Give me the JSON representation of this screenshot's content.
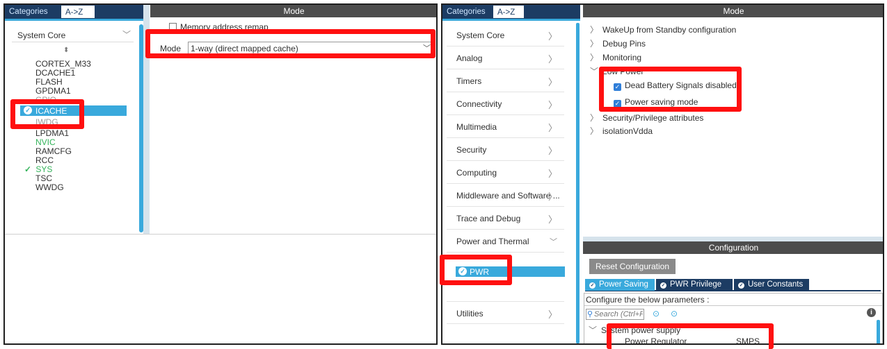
{
  "left": {
    "tabs": [
      "Categories",
      "A->Z"
    ],
    "mode_header": "Mode",
    "category": "System Core",
    "peripherals": [
      {
        "label": "CORTEX_M33",
        "status": "normal"
      },
      {
        "label": "DCACHE1",
        "status": "normal"
      },
      {
        "label": "FLASH",
        "status": "normal"
      },
      {
        "label": "GPDMA1",
        "status": "normal"
      },
      {
        "label": "GPIO",
        "status": "hidden"
      },
      {
        "label": "ICACHE",
        "status": "selected"
      },
      {
        "label": "IWDG",
        "status": "hidden"
      },
      {
        "label": "LPDMA1",
        "status": "normal"
      },
      {
        "label": "NVIC",
        "status": "green"
      },
      {
        "label": "RAMCFG",
        "status": "normal"
      },
      {
        "label": "RCC",
        "status": "normal"
      },
      {
        "label": "SYS",
        "status": "check"
      },
      {
        "label": "TSC",
        "status": "normal"
      },
      {
        "label": "WWDG",
        "status": "normal"
      }
    ],
    "remap_label": "Memory address remap",
    "mode_label": "Mode",
    "mode_value": "1-way (direct mapped cache)"
  },
  "right": {
    "tabs": [
      "Categories",
      "A->Z"
    ],
    "mode_header": "Mode",
    "categories": [
      "System Core",
      "Analog",
      "Timers",
      "Connectivity",
      "Multimedia",
      "Security",
      "Computing",
      "Middleware and Software ...",
      "Trace and Debug",
      "Power and Thermal"
    ],
    "selected_item": "PWR",
    "utilities": "Utilities",
    "mode_tree": [
      {
        "label": "WakeUp from Standby configuration"
      },
      {
        "label": "Debug Pins"
      },
      {
        "label": "Monitoring"
      },
      {
        "label": "Low Power"
      }
    ],
    "checkboxes": [
      "Dead Battery Signals disabled",
      "Power saving mode"
    ],
    "mode_tree_after": [
      {
        "label": "Security/Privilege attributes"
      },
      {
        "label": "isolationVdda"
      }
    ],
    "config_header": "Configuration",
    "reset_button": "Reset Configuration",
    "config_tabs": [
      "Power Saving",
      "PWR Privilege",
      "User Constants"
    ],
    "configure_label": "Configure the below parameters :",
    "search_placeholder": "Search (Ctrl+F)",
    "section": "System power supply",
    "param_name": "Power Regulator",
    "param_value": "SMPS"
  },
  "colors": {
    "accent": "#39a9dc",
    "navy": "#1c3c63",
    "highlight": "#ff1010",
    "green": "#34b35a"
  }
}
